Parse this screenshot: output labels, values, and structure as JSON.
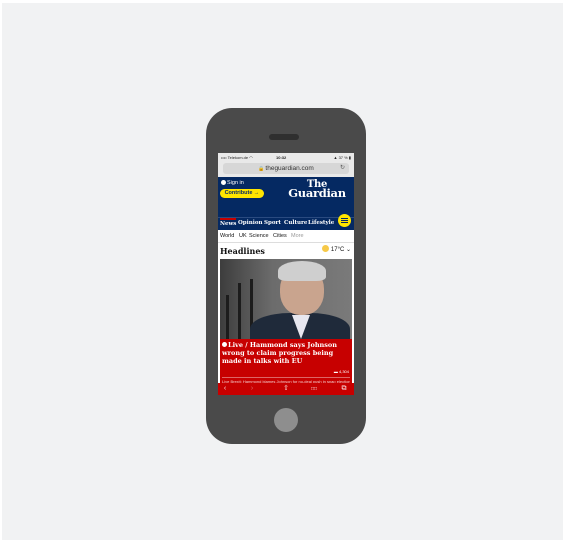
{
  "status_bar": {
    "carrier": "•••• Telekom.de ◠",
    "time": "10:32",
    "battery": "▲ 37 % ▮"
  },
  "browser": {
    "url": "theguardian.com",
    "lock_icon": "lock-icon",
    "reload_icon": "reload-icon"
  },
  "masthead": {
    "sign_in": "Sign in",
    "contribute": "Contribute →",
    "logo_line1": "The",
    "logo_line2": "Guardian"
  },
  "nav": {
    "items": [
      "News",
      "Opinion",
      "Sport",
      "Culture",
      "Lifestyle"
    ]
  },
  "subnav": {
    "items": [
      "World",
      "UK",
      "Science",
      "Cities"
    ],
    "more": "More"
  },
  "section": {
    "title": "Headlines",
    "weather": "17°C ⌄"
  },
  "story": {
    "kicker": "Live / ",
    "headline": "Hammond says Johnson wrong to claim progress being made in talks with EU",
    "comments": "▬ 4,304",
    "next": "Live Brexit: Hammond blames Johnson for no-deal push in snap election"
  },
  "toolbar": {
    "back": "‹",
    "forward": "›",
    "share": "⇧",
    "bookmarks": "□□",
    "tabs": "⧉"
  },
  "colors": {
    "guardian_blue": "#052962",
    "guardian_yellow": "#ffe500",
    "live_red": "#c70000"
  }
}
